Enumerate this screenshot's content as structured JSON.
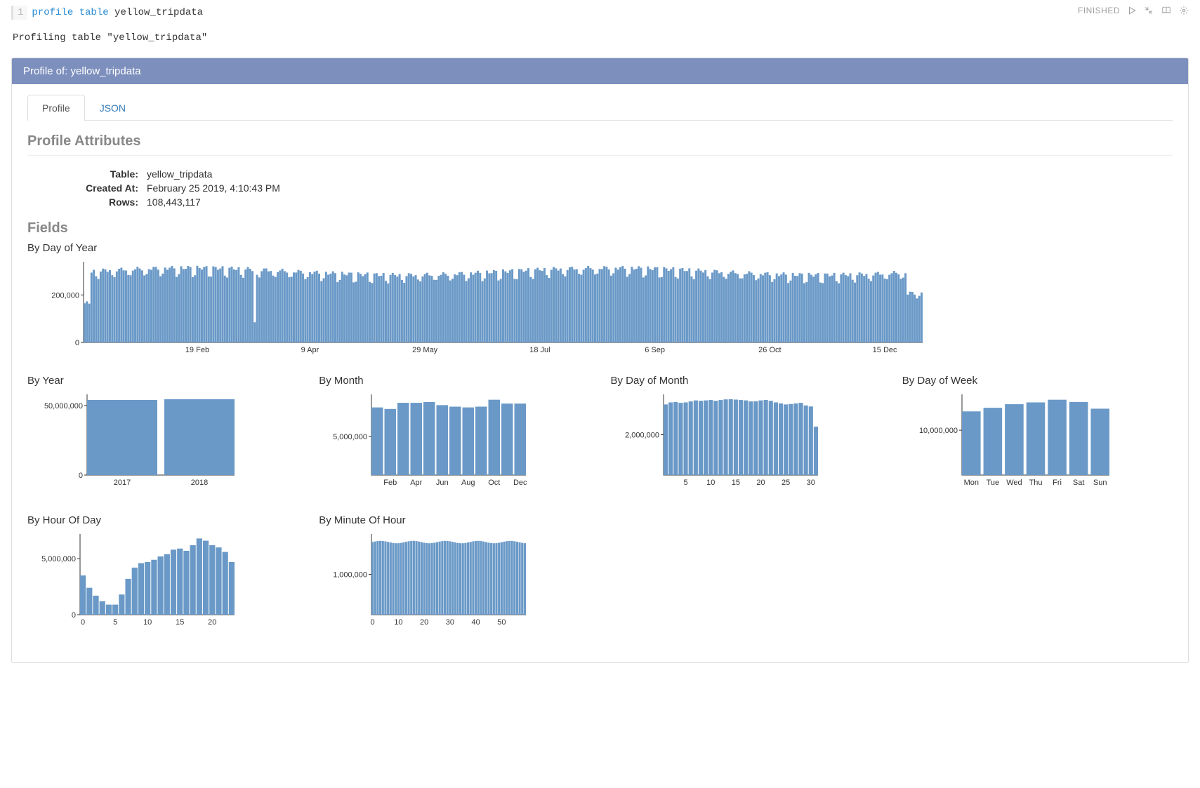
{
  "cell": {
    "line_number": "1",
    "code_html": "<span class='kw'>profile</span> <span class='kw'>table</span> <span class='ident'>yellow_tripdata</span>",
    "status": "FINISHED",
    "output": "Profiling table \"yellow_tripdata\""
  },
  "panel": {
    "header": "Profile of: yellow_tripdata",
    "tabs": [
      "Profile",
      "JSON"
    ],
    "active_tab": 0
  },
  "sections": {
    "attrs_title": "Profile Attributes",
    "fields_title": "Fields"
  },
  "attrs": [
    {
      "label": "Table:",
      "value": "yellow_tripdata"
    },
    {
      "label": "Created At:",
      "value": "February 25 2019, 4:10:43 PM"
    },
    {
      "label": "Rows:",
      "value": "108,443,117"
    }
  ],
  "chart_data": [
    {
      "id": "by-day-of-year",
      "title": "By Day of Year",
      "type": "bar",
      "ylabel": "",
      "yticks": [
        0,
        200000
      ],
      "ytick_labels": [
        "0",
        "200,000"
      ],
      "ylim": [
        0,
        340000
      ],
      "xticks": [
        "19 Feb",
        "9 Apr",
        "29 May",
        "18 Jul",
        "6 Sep",
        "26 Oct",
        "15 Dec"
      ],
      "values_note": "365 daily counts; approximate uniform ~290k-330k with weekly dips and early-Jan/late-Dec low days (~130k-180k)",
      "values": []
    },
    {
      "id": "by-year",
      "title": "By Year",
      "type": "bar",
      "categories": [
        "2017",
        "2018"
      ],
      "values": [
        54000000,
        54500000
      ],
      "yticks": [
        0,
        50000000
      ],
      "ytick_labels": [
        "0",
        "50,000,000"
      ],
      "ylim": [
        0,
        58000000
      ]
    },
    {
      "id": "by-month",
      "title": "By Month",
      "type": "bar",
      "categories": [
        "Jan",
        "Feb",
        "Mar",
        "Apr",
        "May",
        "Jun",
        "Jul",
        "Aug",
        "Sep",
        "Oct",
        "Nov",
        "Dec"
      ],
      "xticks": [
        "Feb",
        "Apr",
        "Jun",
        "Aug",
        "Oct",
        "Dec"
      ],
      "values": [
        8800000,
        8600000,
        9400000,
        9400000,
        9500000,
        9100000,
        8900000,
        8800000,
        8900000,
        9800000,
        9300000,
        9300000
      ],
      "yticks": [
        5000000
      ],
      "ytick_labels": [
        "5,000,000"
      ],
      "ylim": [
        0,
        10500000
      ]
    },
    {
      "id": "by-day-of-month",
      "title": "By Day of Month",
      "type": "bar",
      "categories": [
        1,
        2,
        3,
        4,
        5,
        6,
        7,
        8,
        9,
        10,
        11,
        12,
        13,
        14,
        15,
        16,
        17,
        18,
        19,
        20,
        21,
        22,
        23,
        24,
        25,
        26,
        27,
        28,
        29,
        30,
        31
      ],
      "xticks": [
        5,
        10,
        15,
        20,
        25,
        30
      ],
      "values": [
        3500000,
        3600000,
        3620000,
        3580000,
        3600000,
        3650000,
        3700000,
        3680000,
        3700000,
        3720000,
        3680000,
        3720000,
        3750000,
        3760000,
        3740000,
        3720000,
        3700000,
        3650000,
        3660000,
        3700000,
        3720000,
        3680000,
        3600000,
        3550000,
        3500000,
        3520000,
        3550000,
        3580000,
        3450000,
        3400000,
        2400000
      ],
      "yticks": [
        2000000
      ],
      "ytick_labels": [
        "2,000,000"
      ],
      "ylim": [
        0,
        4000000
      ]
    },
    {
      "id": "by-day-of-week",
      "title": "By Day of Week",
      "type": "bar",
      "categories": [
        "Mon",
        "Tue",
        "Wed",
        "Thu",
        "Fri",
        "Sat",
        "Sun"
      ],
      "values": [
        14200000,
        15000000,
        15800000,
        16200000,
        16800000,
        16300000,
        14800000
      ],
      "yticks": [
        10000000
      ],
      "ytick_labels": [
        "10,000,000"
      ],
      "ylim": [
        0,
        18000000
      ]
    },
    {
      "id": "by-hour-of-day",
      "title": "By Hour Of Day",
      "type": "bar",
      "categories": [
        0,
        1,
        2,
        3,
        4,
        5,
        6,
        7,
        8,
        9,
        10,
        11,
        12,
        13,
        14,
        15,
        16,
        17,
        18,
        19,
        20,
        21,
        22,
        23
      ],
      "xticks": [
        0,
        5,
        10,
        15,
        20
      ],
      "values": [
        3500000,
        2400000,
        1700000,
        1200000,
        900000,
        900000,
        1800000,
        3200000,
        4200000,
        4600000,
        4700000,
        4900000,
        5200000,
        5400000,
        5800000,
        5900000,
        5700000,
        6200000,
        6800000,
        6600000,
        6200000,
        6000000,
        5600000,
        4700000
      ],
      "yticks": [
        0,
        5000000
      ],
      "ytick_labels": [
        "0",
        "5,000,000"
      ],
      "ylim": [
        0,
        7200000
      ]
    },
    {
      "id": "by-minute-of-hour",
      "title": "By Minute Of Hour",
      "type": "bar",
      "categories_range": [
        0,
        59
      ],
      "xticks": [
        0,
        10,
        20,
        30,
        40,
        50
      ],
      "values_note": "60 uniform bars around ~1,800,000 each",
      "yticks": [
        1000000
      ],
      "ytick_labels": [
        "1,000,000"
      ],
      "ylim": [
        0,
        2000000
      ]
    }
  ]
}
